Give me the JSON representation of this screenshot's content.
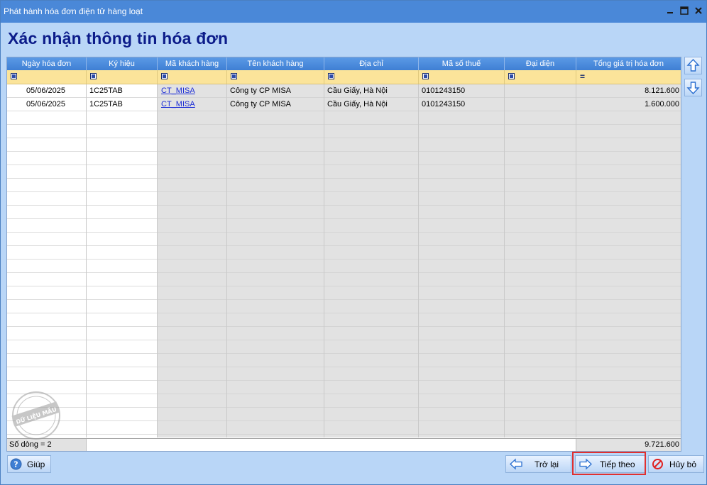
{
  "window": {
    "title": "Phát hành hóa đơn điện tử hàng loạt",
    "heading": "Xác nhận thông tin hóa đơn"
  },
  "grid": {
    "columns": [
      "Ngày hóa đơn",
      "Ký hiệu",
      "Mã khách hàng",
      "Tên khách hàng",
      "Địa chỉ",
      "Mã số thuế",
      "Đại diện",
      "Tổng giá trị hóa đơn"
    ],
    "rows": [
      {
        "ngay": "05/06/2025",
        "ky_hieu": "1C25TAB",
        "ma_kh": "CT_MISA",
        "ten_kh": "Công ty CP MISA",
        "dia_chi": "Cầu Giấy, Hà Nội",
        "mst": "0101243150",
        "dai_dien": "",
        "tong": "8.121.600"
      },
      {
        "ngay": "05/06/2025",
        "ky_hieu": "1C25TAB",
        "ma_kh": "CT_MISA",
        "ten_kh": "Công ty CP MISA",
        "dia_chi": "Cầu Giấy, Hà Nội",
        "mst": "0101243150",
        "dai_dien": "",
        "tong": "1.600.000"
      }
    ],
    "footer": {
      "row_count": "Số dòng = 2",
      "total": "9.721.600"
    }
  },
  "watermark_text": "DỮ LIỆU MẪU",
  "buttons": {
    "help": "Giúp",
    "back": "Trở lại",
    "next": "Tiếp theo",
    "cancel": "Hủy bỏ"
  },
  "colors": {
    "titlebar": "#4a88d8",
    "heading": "#0c1c8a",
    "highlight": "#e03030",
    "filter_row": "#fbe49a"
  }
}
